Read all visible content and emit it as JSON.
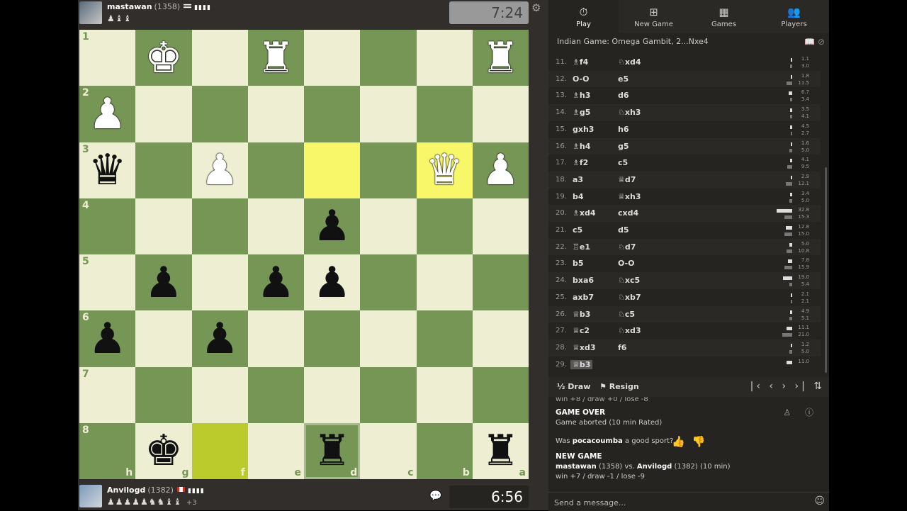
{
  "top_player": {
    "name": "mastawan",
    "rating": "(1358)",
    "bars": "▮▮▮▮",
    "captured": "♟♝♝",
    "clock": "7:24"
  },
  "bottom_player": {
    "name": "Anvilogd",
    "rating": "(1382)",
    "bars": "▮▮▮▮",
    "captured": "♟♟♟♟♟♞♞♝♝",
    "advantage": "+3",
    "clock": "6:56"
  },
  "board": {
    "rank_labels": [
      "1",
      "2",
      "3",
      "4",
      "5",
      "6",
      "7",
      "8"
    ],
    "file_labels": [
      "h",
      "g",
      "f",
      "e",
      "d",
      "c",
      "b",
      "a"
    ],
    "rows": [
      [
        "",
        "wK",
        "",
        "wR",
        "",
        "",
        "",
        "wR"
      ],
      [
        "wP",
        "",
        "",
        "",
        "",
        "",
        "",
        ""
      ],
      [
        "bQ",
        "",
        "wP",
        "",
        "",
        "",
        "wQ",
        "wP"
      ],
      [
        "",
        "",
        "",
        "",
        "bP",
        "",
        "",
        ""
      ],
      [
        "",
        "bP",
        "",
        "bP",
        "bP",
        "",
        "",
        ""
      ],
      [
        "bP",
        "",
        "bP",
        "",
        "",
        "",
        "",
        ""
      ],
      [
        "",
        "",
        "",
        "",
        "",
        "",
        "",
        ""
      ],
      [
        "",
        "bK",
        "",
        "",
        "bR",
        "",
        "",
        "bR"
      ]
    ],
    "highlight": [
      "2-4",
      "2-6"
    ],
    "highlight2": [
      "7-2"
    ],
    "selected": [
      "7-4"
    ]
  },
  "tabs": [
    {
      "label": "Play",
      "icon": "⏱"
    },
    {
      "label": "New Game",
      "icon": "⊞"
    },
    {
      "label": "Games",
      "icon": "▦"
    },
    {
      "label": "Players",
      "icon": "👥"
    }
  ],
  "opening": "Indian Game: Omega Gambit, 2...Nxe4",
  "moves": [
    {
      "n": "11.",
      "w": "♗f4",
      "b": "♘xd4",
      "tw": "1.1",
      "tb": "3.0",
      "ww": 2,
      "wb": 3
    },
    {
      "n": "12.",
      "w": "O-O",
      "b": "e5",
      "tw": "1.8",
      "tb": "11.5",
      "ww": 2,
      "wb": 8
    },
    {
      "n": "13.",
      "w": "♗h3",
      "b": "d6",
      "tw": "6.7",
      "tb": "3.4",
      "ww": 5,
      "wb": 3
    },
    {
      "n": "14.",
      "w": "♗g5",
      "b": "♘xh3",
      "tw": "3.5",
      "tb": "4.1",
      "ww": 3,
      "wb": 3
    },
    {
      "n": "15.",
      "w": "gxh3",
      "b": "h6",
      "tw": "4.5",
      "tb": "2.7",
      "ww": 3,
      "wb": 2
    },
    {
      "n": "16.",
      "w": "♗h4",
      "b": "g5",
      "tw": "1.6",
      "tb": "5.0",
      "ww": 2,
      "wb": 4
    },
    {
      "n": "17.",
      "w": "♗f2",
      "b": "c5",
      "tw": "4.1",
      "tb": "9.5",
      "ww": 3,
      "wb": 7
    },
    {
      "n": "18.",
      "w": "a3",
      "b": "♕d7",
      "tw": "2.9",
      "tb": "12.1",
      "ww": 2,
      "wb": 9
    },
    {
      "n": "19.",
      "w": "b4",
      "b": "♕xh3",
      "tw": "3.4",
      "tb": "5.0",
      "ww": 3,
      "wb": 4
    },
    {
      "n": "20.",
      "w": "♗xd4",
      "b": "cxd4",
      "tw": "32.8",
      "tb": "15.3",
      "ww": 22,
      "wb": 11
    },
    {
      "n": "21.",
      "w": "c5",
      "b": "d5",
      "tw": "12.8",
      "tb": "15.0",
      "ww": 9,
      "wb": 11
    },
    {
      "n": "22.",
      "w": "♖e1",
      "b": "♘d7",
      "tw": "5.0",
      "tb": "10.8",
      "ww": 4,
      "wb": 8
    },
    {
      "n": "23.",
      "w": "b5",
      "b": "O-O",
      "tw": "7.8",
      "tb": "15.9",
      "ww": 6,
      "wb": 11
    },
    {
      "n": "24.",
      "w": "bxa6",
      "b": "♘xc5",
      "tw": "19.0",
      "tb": "5.4",
      "ww": 13,
      "wb": 4
    },
    {
      "n": "25.",
      "w": "axb7",
      "b": "♘xb7",
      "tw": "2.1",
      "tb": "2.1",
      "ww": 2,
      "wb": 2
    },
    {
      "n": "26.",
      "w": "♕b3",
      "b": "♘c5",
      "tw": "4.9",
      "tb": "5.1",
      "ww": 3,
      "wb": 4
    },
    {
      "n": "27.",
      "w": "♕c2",
      "b": "♘xd3",
      "tw": "11.1",
      "tb": "21.0",
      "ww": 8,
      "wb": 14
    },
    {
      "n": "28.",
      "w": "♕xd3",
      "b": "f6",
      "tw": "1.2",
      "tb": "5.0",
      "ww": 2,
      "wb": 4
    },
    {
      "n": "29.",
      "w": "♕b3",
      "b": "",
      "tw": "11.0",
      "tb": "",
      "ww": 8,
      "wb": 0
    }
  ],
  "actions": {
    "draw_icon": "½",
    "draw": "Draw",
    "resign_icon": "⚑",
    "resign": "Resign",
    "nav": "|‹ ‹ › ›| ⇅"
  },
  "chat": {
    "prev_stats": "win +8 / draw +0 / lose -8",
    "game_over_title": "GAME OVER",
    "game_over_text": "Game aborted (10 min Rated)",
    "sport_prefix": "Was",
    "sport_name": "pocacoumba",
    "sport_suffix": "a good sport?",
    "new_game_title": "NEW GAME",
    "new_game_white": "mastawan",
    "new_game_white_rating": "(1358)",
    "new_game_vs": "vs.",
    "new_game_black": "Anvilogd",
    "new_game_black_rating": "(1382) (10 min)",
    "new_game_stats": "win +7 / draw -1 / lose -9"
  },
  "message": {
    "placeholder": "Send a message..."
  }
}
